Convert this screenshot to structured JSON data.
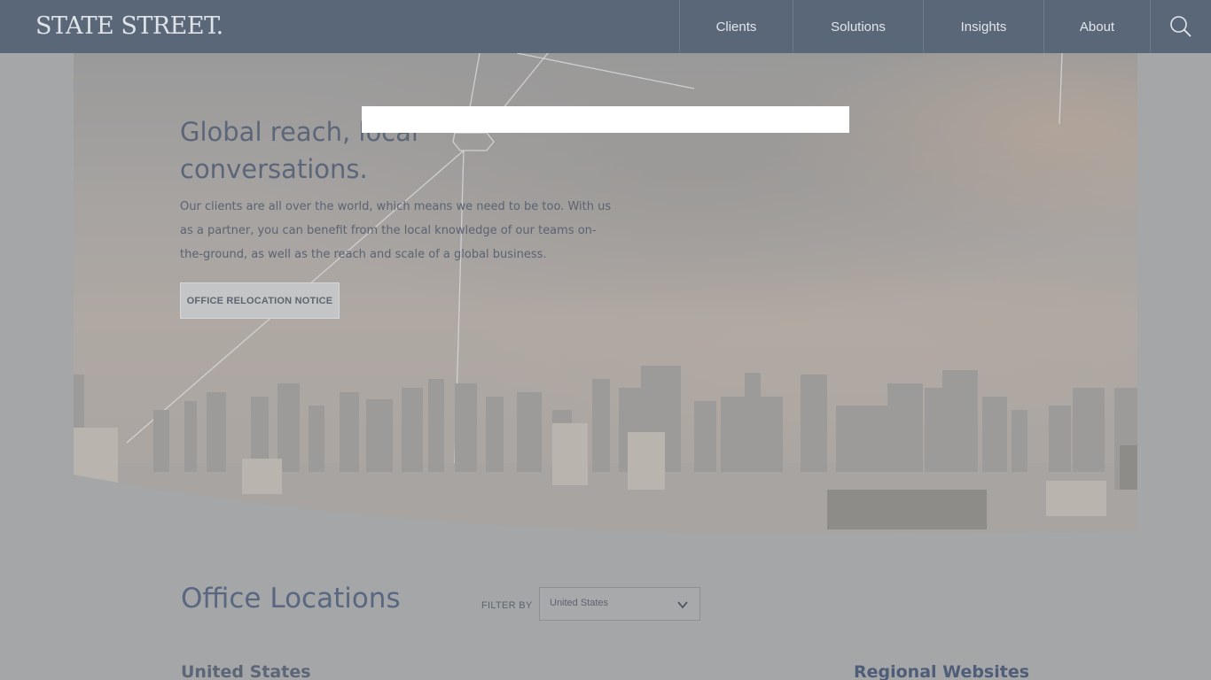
{
  "header": {
    "logo": "STATE STREET.",
    "nav": [
      "Clients",
      "Solutions",
      "Insights",
      "About"
    ],
    "search_icon": "search-icon"
  },
  "hero": {
    "title": "Global reach, local conversations.",
    "text": "Our clients are all over the world, which means we need to be too. With us as a partner, you can benefit from the local knowledge of our teams on-the-ground, as well as the reach and scale of a global business.",
    "button": "OFFICE RELOCATION NOTICE"
  },
  "offices": {
    "title": "Office Locations",
    "filter_label": "FILTER BY",
    "filter_value": "United States",
    "country_heading": "United States",
    "regional_heading": "Regional Websites"
  },
  "colors": {
    "header_bg": "#5a6779",
    "overlay_bg": "#a4a6a8",
    "accent_text": "#5a6780"
  }
}
